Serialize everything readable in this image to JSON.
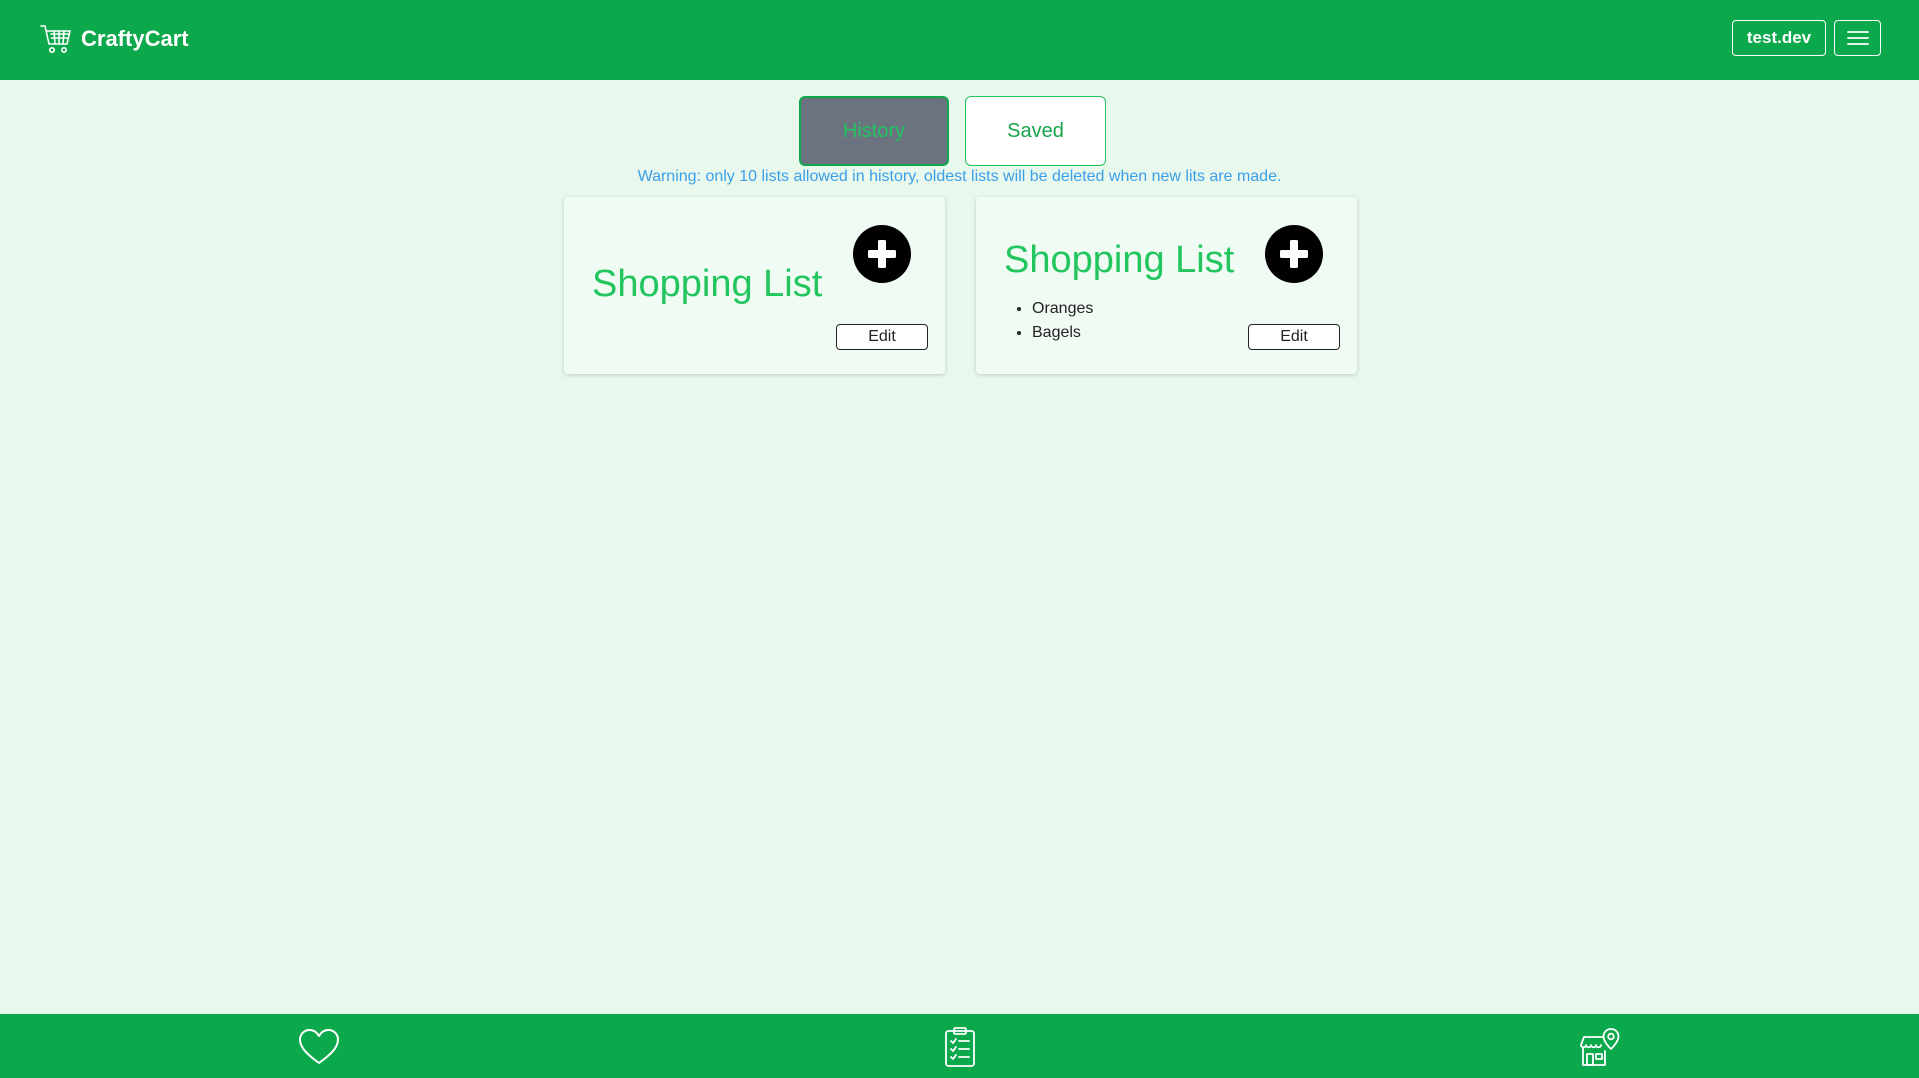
{
  "header": {
    "brand": "CraftyCart",
    "user_label": "test.dev",
    "brand_icon": "shopping-cart-icon",
    "menu_icon": "hamburger-menu-icon"
  },
  "tabs": {
    "history_label": "History",
    "saved_label": "Saved",
    "active": "History"
  },
  "warning_text": "Warning: only 10 lists allowed in history, oldest lists will be deleted when new lits are made.",
  "cards": [
    {
      "title": "Shopping List",
      "items": [],
      "edit_label": "Edit"
    },
    {
      "title": "Shopping List",
      "items": [
        "Oranges",
        "Bagels"
      ],
      "edit_label": "Edit"
    }
  ],
  "bottom_nav": {
    "icons": [
      "heart-icon",
      "clipboard-checklist-icon",
      "store-location-icon"
    ]
  },
  "colors": {
    "primary": "#0ca84c",
    "background": "#e8f8ed",
    "accent_text": "#22c55e",
    "warning": "#3b9fe8"
  }
}
